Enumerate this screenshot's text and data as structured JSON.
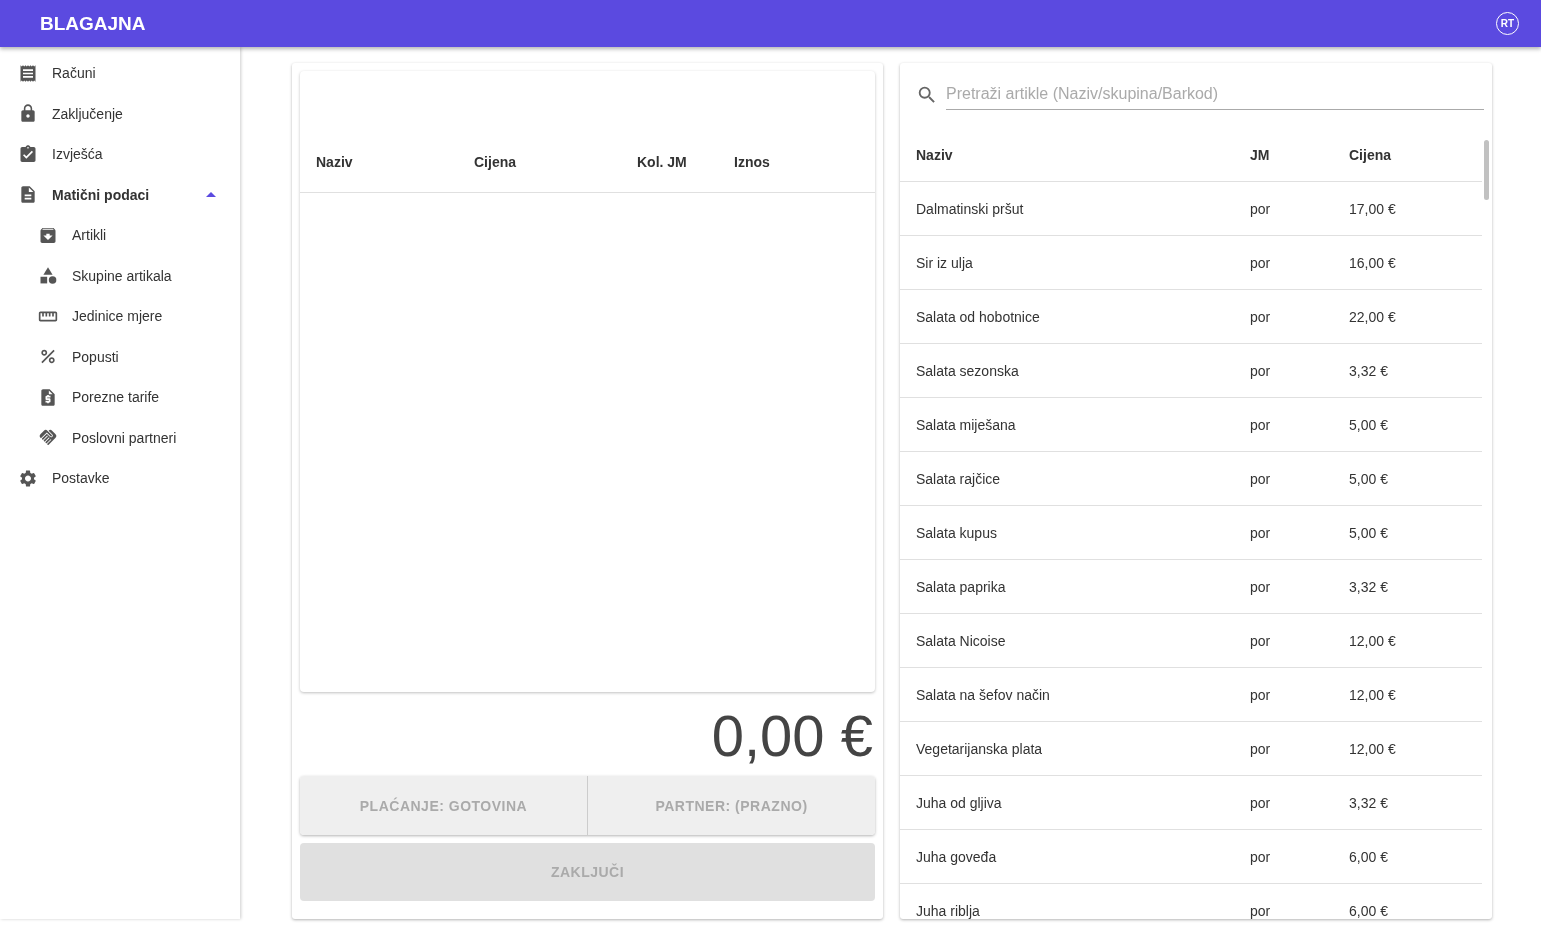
{
  "app_bar": {
    "title": "BLAGAJNA",
    "avatar": "RT"
  },
  "sidebar": {
    "items": [
      {
        "label": "Računi"
      },
      {
        "label": "Zaključenje"
      },
      {
        "label": "Izvješća"
      },
      {
        "label": "Matični podaci",
        "expanded": true,
        "children": [
          {
            "label": "Artikli"
          },
          {
            "label": "Skupine artikala"
          },
          {
            "label": "Jedinice mjere"
          },
          {
            "label": "Popusti"
          },
          {
            "label": "Porezne tarife"
          },
          {
            "label": "Poslovni partneri"
          }
        ]
      },
      {
        "label": "Postavke"
      }
    ]
  },
  "cart": {
    "columns": [
      "Naziv",
      "Cijena",
      "Kol. JM",
      "Iznos"
    ],
    "total": "0,00 €",
    "payment_button": "PLAĆANJE: GOTOVINA",
    "partner_button": "PARTNER: (PRAZNO)",
    "close_button": "ZAKLJUČI"
  },
  "products": {
    "search": {
      "placeholder": "Pretraži artikle (Naziv/skupina/Barkod)"
    },
    "columns": [
      "Naziv",
      "JM",
      "Cijena"
    ],
    "rows": [
      [
        "Dalmatinski pršut",
        "por",
        "17,00 €"
      ],
      [
        "Sir iz ulja",
        "por",
        "16,00 €"
      ],
      [
        "Salata od hobotnice",
        "por",
        "22,00 €"
      ],
      [
        "Salata sezonska",
        "por",
        "3,32 €"
      ],
      [
        "Salata miješana",
        "por",
        "5,00 €"
      ],
      [
        "Salata rajčice",
        "por",
        "5,00 €"
      ],
      [
        "Salata kupus",
        "por",
        "5,00 €"
      ],
      [
        "Salata paprika",
        "por",
        "3,32 €"
      ],
      [
        "Salata Nicoise",
        "por",
        "12,00 €"
      ],
      [
        "Salata na šefov način",
        "por",
        "12,00 €"
      ],
      [
        "Vegetarijanska plata",
        "por",
        "12,00 €"
      ],
      [
        "Juha od gljiva",
        "por",
        "3,32 €"
      ],
      [
        "Juha goveđa",
        "por",
        "6,00 €"
      ],
      [
        "Juha riblja",
        "por",
        "6,00 €"
      ]
    ]
  }
}
